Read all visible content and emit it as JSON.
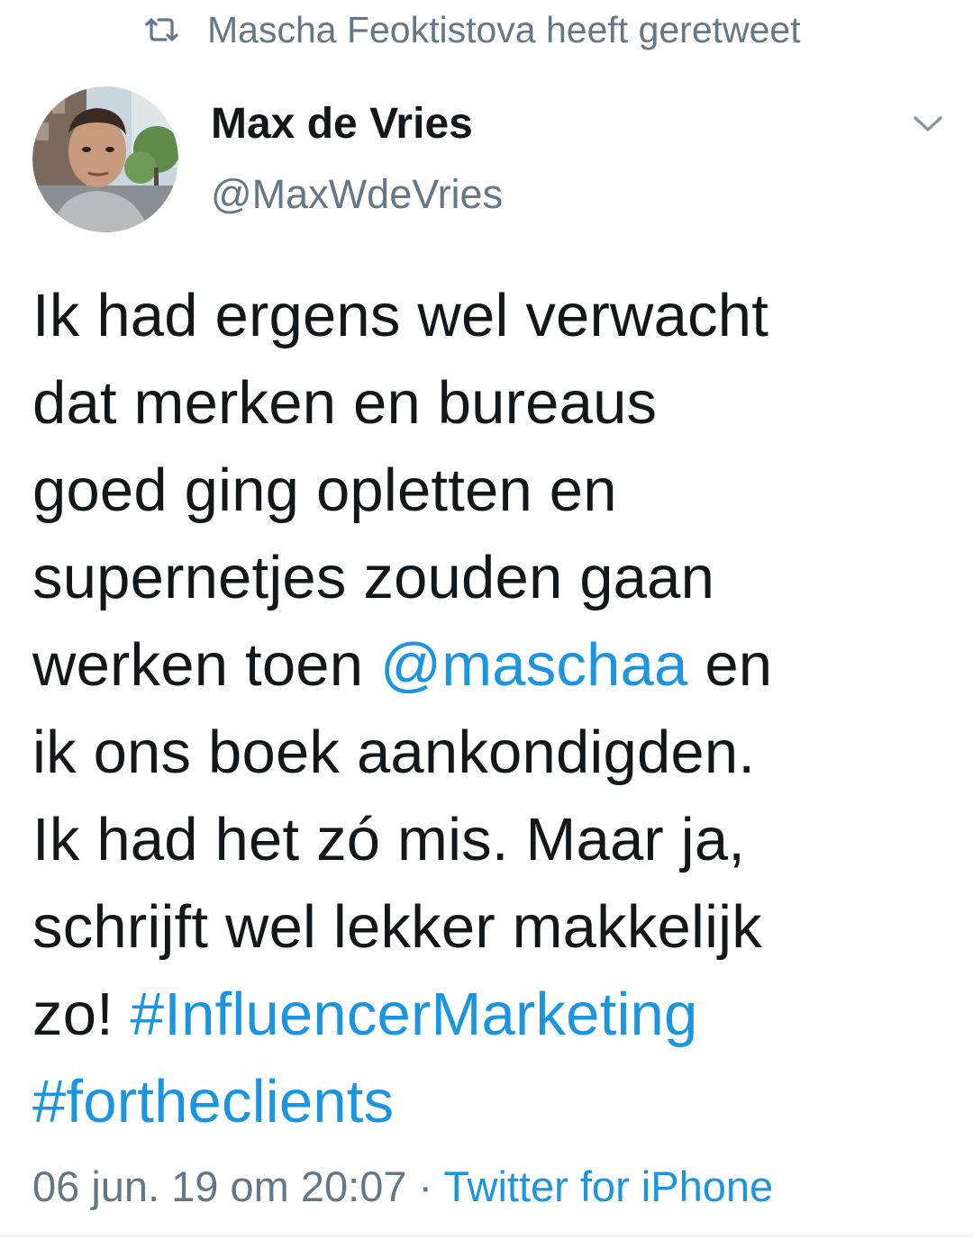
{
  "retweet": {
    "icon": "retweet-icon",
    "text": "Mascha Feoktistova heeft geretweet"
  },
  "author": {
    "name": "Max de Vries",
    "handle": "@MaxWdeVries",
    "avatar_icon": "avatar-photo"
  },
  "menu": {
    "icon": "chevron-down-icon"
  },
  "tweet": {
    "lines": [
      [
        {
          "text": "Ik had ergens wel verwacht",
          "type": "text"
        }
      ],
      [
        {
          "text": "dat merken en bureaus",
          "type": "text"
        }
      ],
      [
        {
          "text": "goed ging opletten en",
          "type": "text"
        }
      ],
      [
        {
          "text": "supernetjes zouden gaan",
          "type": "text"
        }
      ],
      [
        {
          "text": "werken toen ",
          "type": "text"
        },
        {
          "text": "@maschaa",
          "type": "mention"
        },
        {
          "text": " en",
          "type": "text"
        }
      ],
      [
        {
          "text": "ik ons boek aankondigden.",
          "type": "text"
        }
      ],
      [
        {
          "text": "Ik had het zó mis. Maar ja,",
          "type": "text"
        }
      ],
      [
        {
          "text": "schrijft wel lekker makkelijk",
          "type": "text"
        }
      ],
      [
        {
          "text": "zo! ",
          "type": "text"
        },
        {
          "text": "#InfluencerMarketing",
          "type": "hashtag"
        }
      ],
      [
        {
          "text": "#fortheclients",
          "type": "hashtag"
        }
      ]
    ]
  },
  "meta": {
    "timestamp": "06 jun. 19 om 20:07",
    "separator": " · ",
    "source": "Twitter for iPhone"
  },
  "colors": {
    "link": "#1b95e0",
    "secondary_text": "#657786",
    "primary_text": "#14171a"
  }
}
